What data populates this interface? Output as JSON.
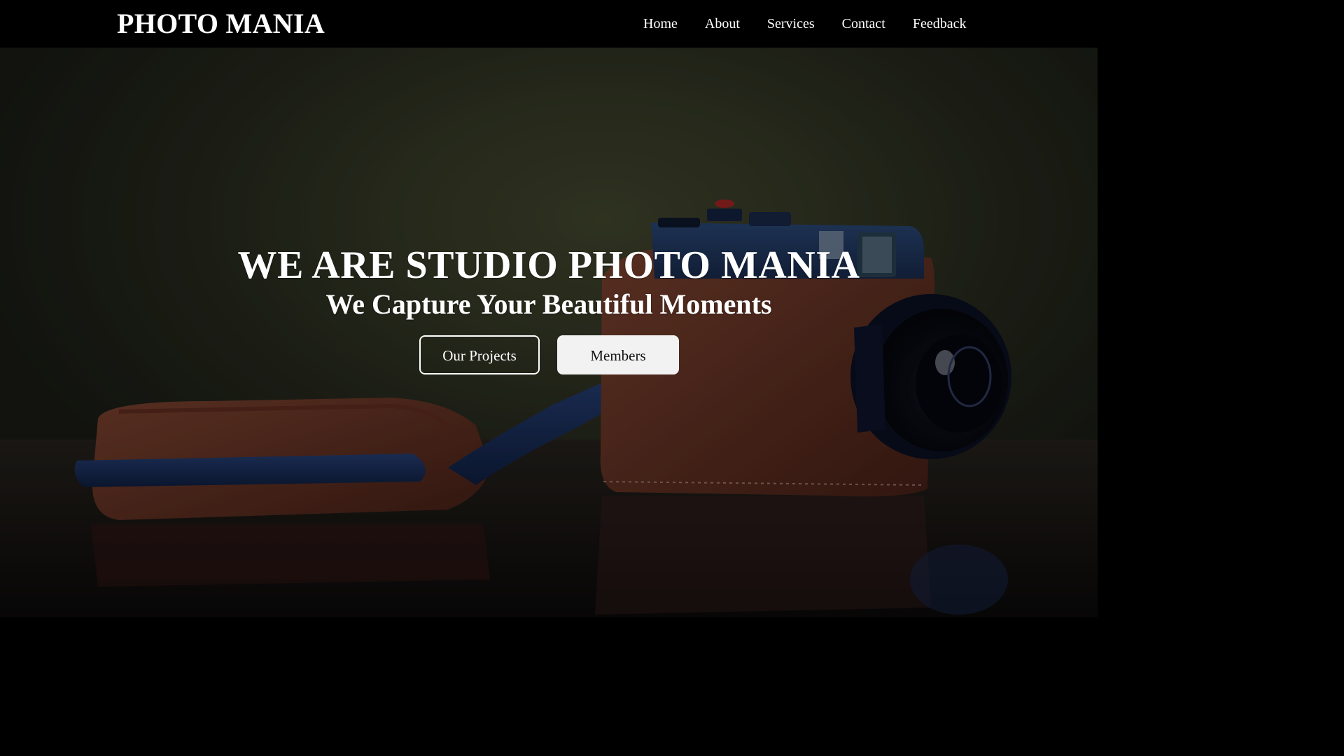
{
  "navbar": {
    "brand": "PHOTO MANIA",
    "links": [
      {
        "label": "Home"
      },
      {
        "label": "About"
      },
      {
        "label": "Services"
      },
      {
        "label": "Contact"
      },
      {
        "label": "Feedback"
      }
    ]
  },
  "hero": {
    "title": "WE ARE STUDIO PHOTO MANIA",
    "subtitle": "We Capture Your Beautiful Moments",
    "buttons": {
      "projects": "Our Projects",
      "members": "Members"
    }
  },
  "colors": {
    "navbar_bg": "#000000",
    "text": "#ffffff",
    "button_solid_bg": "#f2f2f2",
    "button_solid_text": "#111111",
    "hero_bg": "#3b3f2a"
  }
}
